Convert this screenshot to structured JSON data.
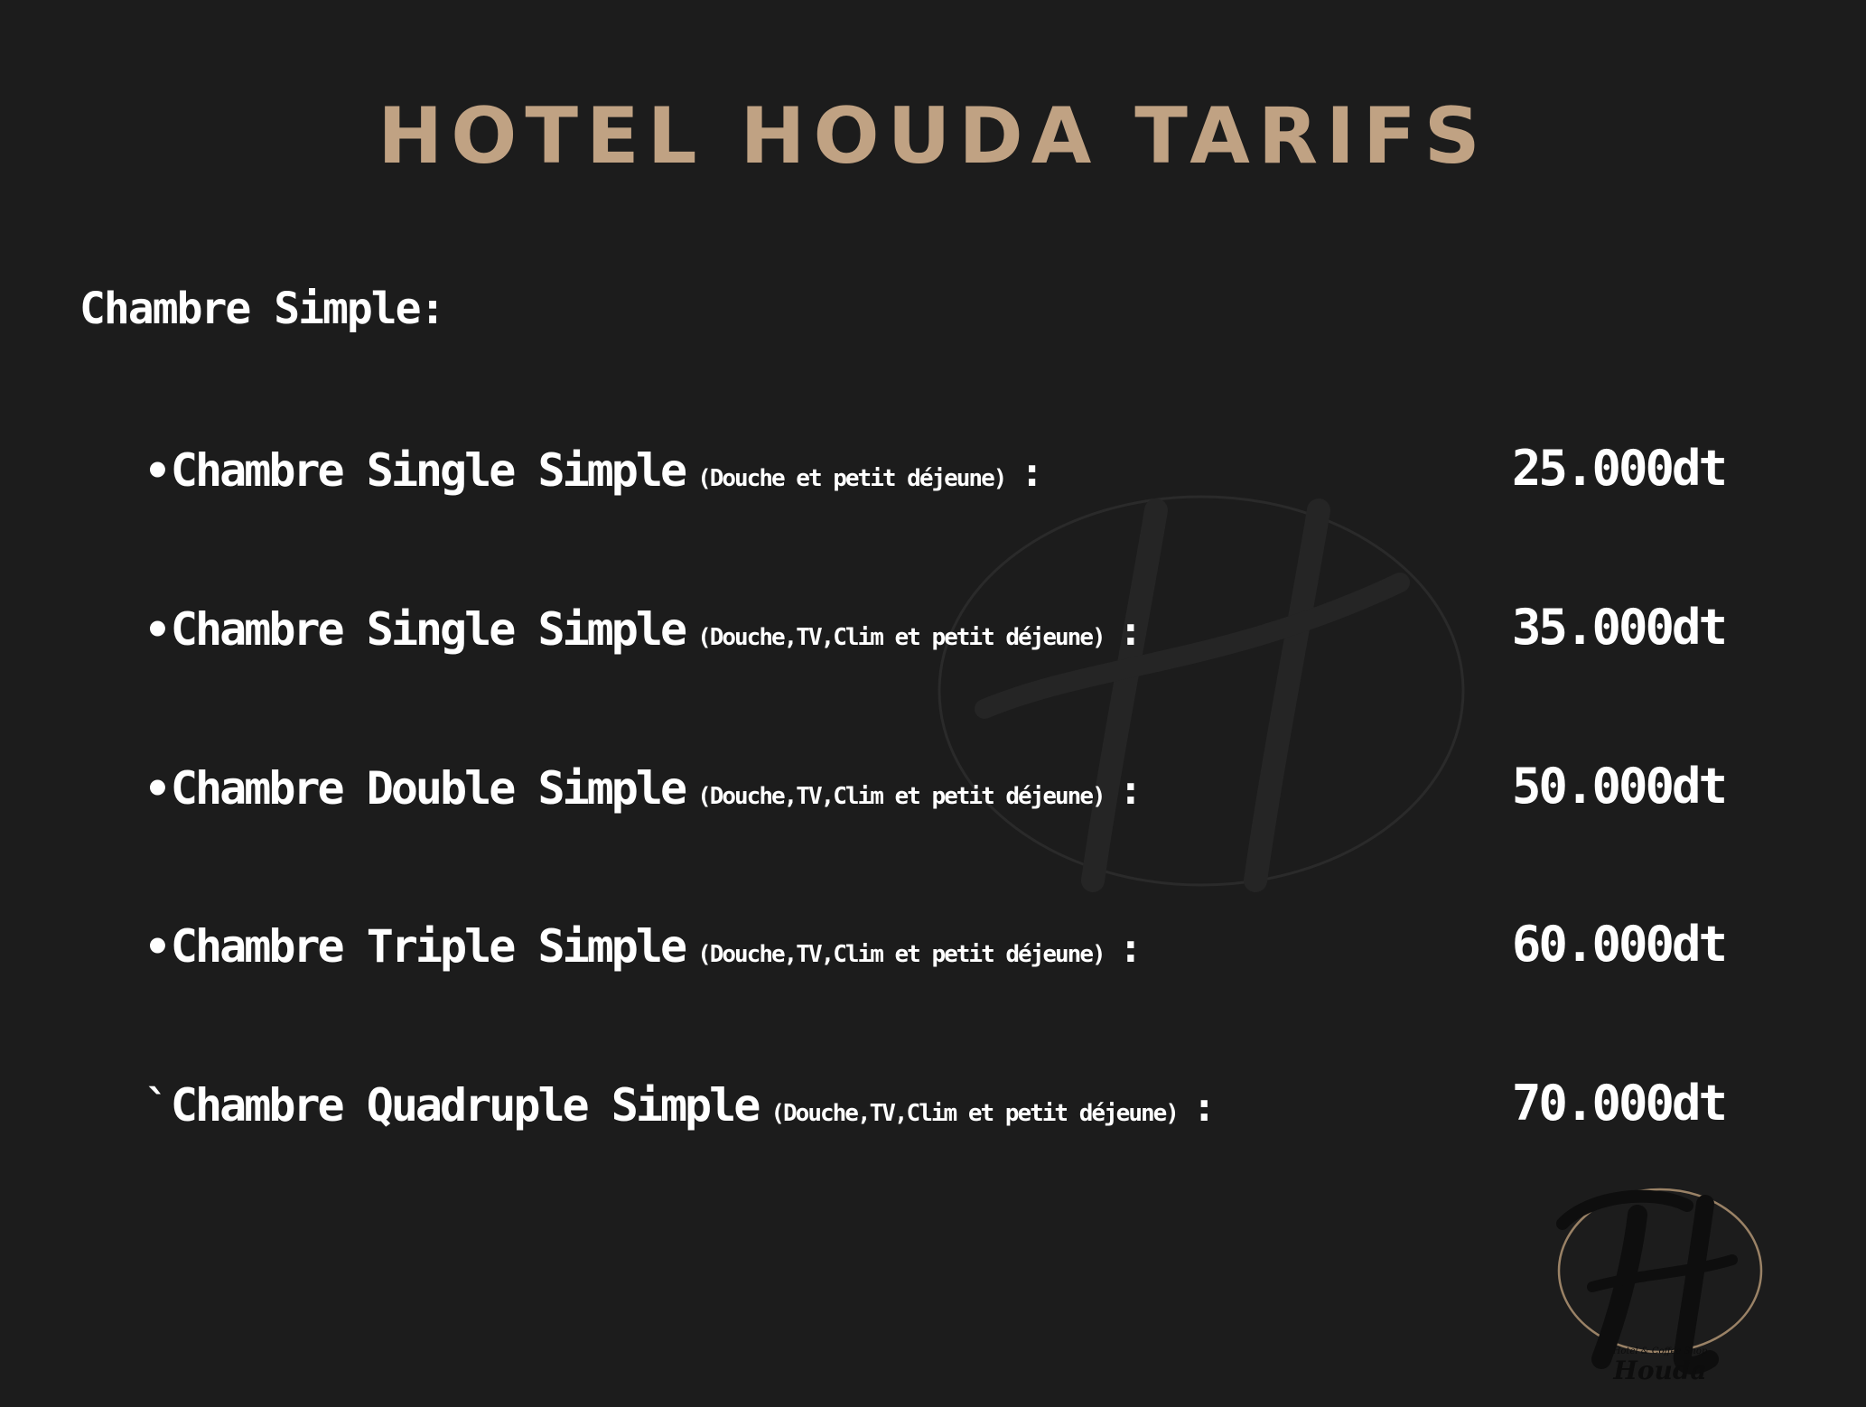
{
  "title": "HOTEL HOUDA TARIFS",
  "section_heading": "Chambre Simple:",
  "rooms": [
    {
      "bullet": "•",
      "name": "Chambre Single Simple",
      "note": "(Douche et petit déjeune)",
      "colon": ":",
      "price": "25.000dt"
    },
    {
      "bullet": "•",
      "name": "Chambre Single Simple",
      "note": "(Douche,TV,Clim et petit déjeune)",
      "colon": ":",
      "price": "35.000dt"
    },
    {
      "bullet": "•",
      "name": "Chambre Double Simple",
      "note": "(Douche,TV,Clim et petit déjeune)",
      "colon": ":",
      "price": "50.000dt"
    },
    {
      "bullet": "•",
      "name": "Chambre Triple Simple",
      "note": "(Douche,TV,Clim et petit déjeune)",
      "colon": ":",
      "price": "60.000dt"
    },
    {
      "bullet": "`",
      "name": "Chambre Quadruple Simple",
      "note": "(Douche,TV,Clim et petit déjeune)",
      "colon": ":",
      "price": "70.000dt"
    }
  ],
  "logo": {
    "tagline": "Hotel & Coffee Shop",
    "name": "Houda"
  },
  "colors": {
    "background": "#1c1c1c",
    "title": "#c0a283",
    "text": "#ffffff"
  },
  "icons": {
    "watermark": "hotel-monogram-watermark-icon",
    "logo": "hotel-houda-logo-icon"
  }
}
